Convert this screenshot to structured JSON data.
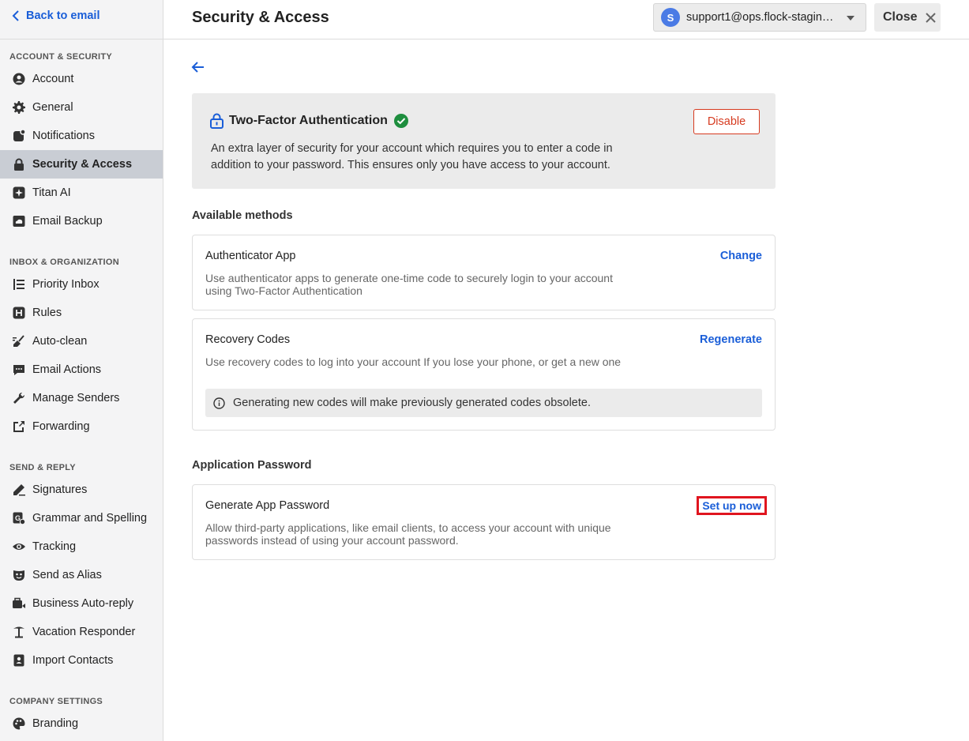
{
  "sidebar": {
    "back_label": "Back to email",
    "sections": {
      "account_security": "ACCOUNT & SECURITY",
      "inbox_org": "INBOX & ORGANIZATION",
      "send_reply": "SEND & REPLY",
      "company_settings": "COMPANY SETTINGS"
    },
    "items": {
      "account": "Account",
      "general": "General",
      "notifications": "Notifications",
      "security": "Security & Access",
      "titan_ai": "Titan AI",
      "email_backup": "Email Backup",
      "priority_inbox": "Priority Inbox",
      "rules": "Rules",
      "auto_clean": "Auto-clean",
      "email_actions": "Email Actions",
      "manage_senders": "Manage Senders",
      "forwarding": "Forwarding",
      "signatures": "Signatures",
      "grammar": "Grammar and Spelling",
      "tracking": "Tracking",
      "send_as_alias": "Send as Alias",
      "business_auto_reply": "Business Auto-reply",
      "vacation_responder": "Vacation Responder",
      "import_contacts": "Import Contacts",
      "branding": "Branding"
    },
    "active_item": "security"
  },
  "header": {
    "title": "Security & Access",
    "avatar_letter": "S",
    "account": "support1@ops.flock-staging.com",
    "close_label": "Close"
  },
  "two_factor": {
    "title": "Two-Factor Authentication",
    "description": "An extra layer of security for your account which requires you to enter a code in addition to your password. This ensures only you have access to your account.",
    "disable_label": "Disable"
  },
  "available_methods": {
    "title": "Available methods",
    "authenticator": {
      "name": "Authenticator App",
      "description": "Use authenticator apps to generate one-time code to securely login to your account using Two-Factor Authentication",
      "action": "Change"
    },
    "recovery": {
      "name": "Recovery Codes",
      "description": "Use recovery codes to log into your account If you lose your phone, or get a new one",
      "action": "Regenerate",
      "note": "Generating new codes will make previously generated codes obsolete."
    }
  },
  "app_password": {
    "title": "Application Password",
    "name": "Generate App Password",
    "description": "Allow third-party applications, like email clients, to access your account with unique passwords instead of using your account password.",
    "action": "Set up now"
  },
  "colors": {
    "accent": "#1a5ed8",
    "danger": "#d63a1f",
    "success": "#1e8e3e",
    "highlight": "#e0151f"
  }
}
